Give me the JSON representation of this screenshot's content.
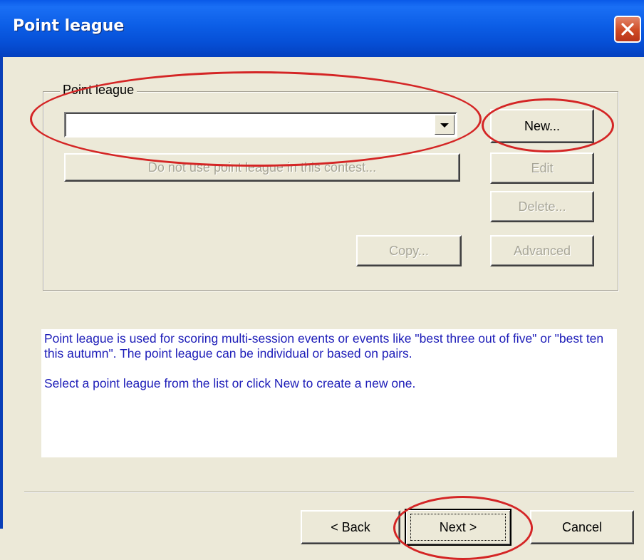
{
  "window": {
    "title": "Point league"
  },
  "group": {
    "label": "Point league"
  },
  "combo": {
    "value": ""
  },
  "buttons": {
    "new": "New...",
    "do_not_use": "Do not use point league in this contest...",
    "edit": "Edit",
    "delete": "Delete...",
    "copy": "Copy...",
    "advanced": "Advanced",
    "back": "< Back",
    "next": "Next >",
    "cancel": "Cancel"
  },
  "info": {
    "paragraph1": "Point league is used for scoring multi-session events or events like \"best three out of five\" or \"best ten this autumn\". The point league can be individual or based on pairs.",
    "paragraph2": "Select a point league from the list or click New to create a new one."
  },
  "icons": {
    "close": "close-icon",
    "dropdown": "chevron-down-icon"
  },
  "colors": {
    "title_bar": "#0a5ae8",
    "dialog_bg": "#ece9d8",
    "info_text": "#1c1cb8",
    "annotation": "#d42525",
    "close_button": "#cf4a24"
  }
}
